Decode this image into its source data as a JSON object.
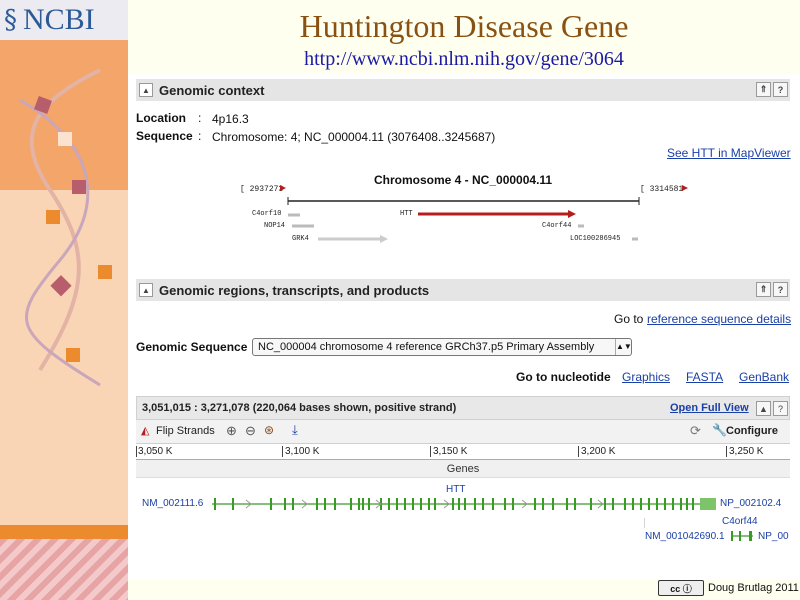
{
  "logo": {
    "mark": "§",
    "text": "NCBI"
  },
  "header": {
    "title": "Huntington Disease Gene",
    "url": "http://www.ncbi.nlm.nih.gov/gene/3064"
  },
  "genomic_context": {
    "heading": "Genomic context",
    "location_label": "Location",
    "location_value": "4p16.3",
    "sequence_label": "Sequence",
    "sequence_value": "Chromosome: 4; NC_000004.11 (3076408..3245687)",
    "mapviewer_link": "See HTT in MapViewer",
    "map": {
      "title": "Chromosome 4 - NC_000004.11",
      "left_coord": "2937273",
      "right_coord": "3314581",
      "genes": [
        "C4orf10",
        "NOP14",
        "GRK4",
        "HTT",
        "C4orf44",
        "LOC100286945"
      ]
    }
  },
  "regions": {
    "heading": "Genomic regions, transcripts, and products",
    "goto_prefix": "Go to",
    "goto_link": "reference sequence details",
    "seq_label": "Genomic Sequence",
    "seq_value": "NC_000004 chromosome 4 reference GRCh37.p5 Primary Assembly",
    "nucleotide_label": "Go to nucleotide",
    "links": [
      "Graphics",
      "FASTA",
      "GenBank"
    ]
  },
  "viewer": {
    "range": "3,051,015 : 3,271,078 (220,064 bases shown, positive strand)",
    "open_full": "Open Full View",
    "flip_strands": "Flip Strands",
    "configure": "Configure",
    "ticks": [
      "3,050 K",
      "3,100 K",
      "3,150 K",
      "3,200 K",
      "3,250 K"
    ],
    "genes_label": "Genes",
    "htt_label": "HTT",
    "left_transcript": "NM_002111.6",
    "right_protein": "NP_002102.4",
    "c4orf44_label": "C4orf44",
    "c4_transcript": "NM_001042690.1",
    "c4_protein": "NP_00"
  },
  "footer": {
    "license": "cc ⓘ",
    "credit": "Doug Brutlag 2011"
  },
  "colors": {
    "title": "#8a5212",
    "url": "#1a1aa6",
    "gene_green": "#3a9a26",
    "htt_red": "#b81b1b"
  }
}
